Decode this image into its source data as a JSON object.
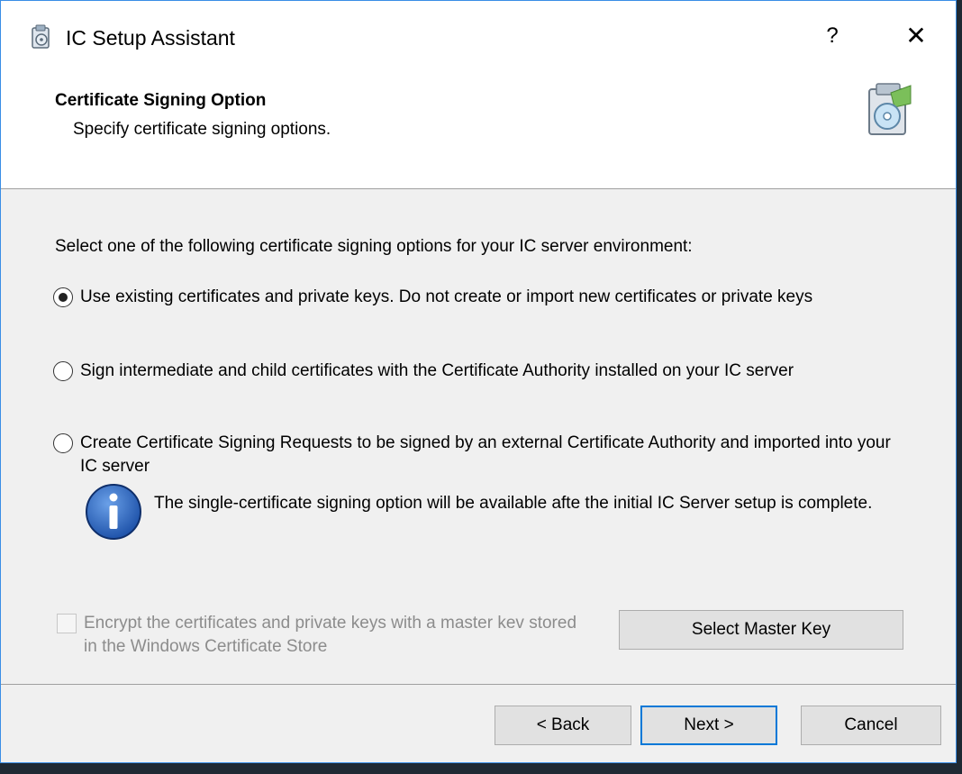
{
  "window": {
    "title": "IC Setup Assistant",
    "help_glyph": "?",
    "close_glyph": "✕",
    "app_icon": "setup-assistant-icon"
  },
  "header": {
    "title": "Certificate Signing Option",
    "subtitle": "Specify certificate signing options.",
    "icon": "setup-disc-icon"
  },
  "content": {
    "instruction": "Select one of the following certificate signing options for your IC server environment:",
    "options": [
      {
        "label": "Use existing certificates and private keys. Do not create or import new certificates or private keys",
        "selected": true
      },
      {
        "label": "Sign intermediate and child certificates with the Certificate Authority installed on your IC server",
        "selected": false
      },
      {
        "label": "Create Certificate Signing Requests to be signed by an external Certificate Authority and imported into your IC server",
        "selected": false
      }
    ],
    "info_icon": "info-icon",
    "info_text": "The single-certificate signing option will be available afte the initial IC Server setup is complete.",
    "encrypt_checkbox": {
      "label": "Encrypt the certificates and private keys with a master kev stored in the Windows Certificate Store",
      "checked": false,
      "enabled": false
    },
    "master_key_button": "Select Master Key"
  },
  "footer": {
    "back": "< Back",
    "next": "Next >",
    "cancel": "Cancel"
  },
  "colors": {
    "accent": "#0078d7",
    "dialog_bg": "#f0f0f0",
    "header_bg": "#ffffff",
    "disabled_text": "#8c8c8c"
  }
}
